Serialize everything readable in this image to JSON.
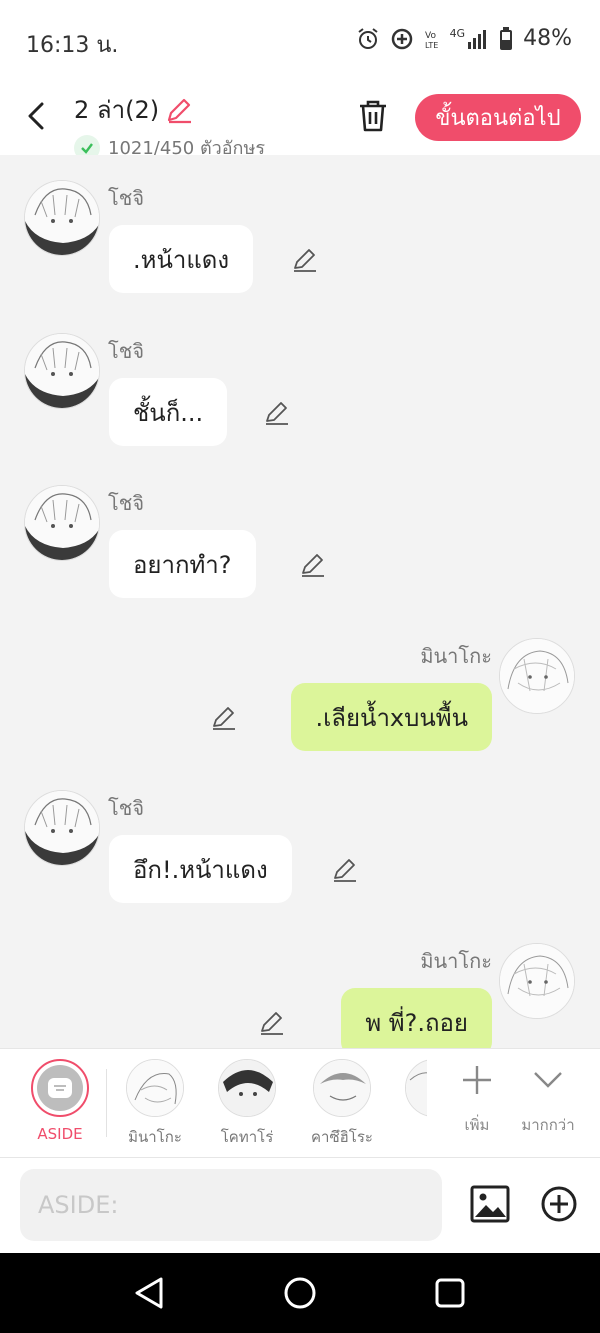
{
  "status": {
    "time": "16:13 น.",
    "battery_pct": "48%",
    "network": "4G"
  },
  "header": {
    "title": "2 ล่า(2)",
    "char_count": "1021/450 ตัวอักษร",
    "next_label": "ขั้นตอนต่อไป",
    "accent_color": "#f04d6b"
  },
  "messages": [
    {
      "side": "left",
      "name": "โชจิ",
      "text": ".หน้าแดง"
    },
    {
      "side": "left",
      "name": "โชจิ",
      "text": "ชั้นก็..."
    },
    {
      "side": "left",
      "name": "โชจิ",
      "text": "อยากทำ?"
    },
    {
      "side": "right",
      "name": "มินาโกะ",
      "text": ".เลียน้ำxบนพื้น"
    },
    {
      "side": "left",
      "name": "โชจิ",
      "text": "อึก!.หน้าแดง"
    },
    {
      "side": "right",
      "name": "มินาโกะ",
      "text": "พ พี่?.ถอย"
    }
  ],
  "characters": {
    "aside_label": "ASIDE",
    "items": [
      "มินาโกะ",
      "โคทาโร่",
      "คาซึฮิโระ"
    ],
    "add_label": "เพิ่ม",
    "more_label": "มากกว่า"
  },
  "composer": {
    "placeholder": "ASIDE:"
  },
  "icons": [
    "back-icon",
    "pencil-icon",
    "trash-icon",
    "check-icon",
    "image-icon",
    "plus-circle-icon",
    "chevron-down-icon",
    "plus-icon"
  ]
}
